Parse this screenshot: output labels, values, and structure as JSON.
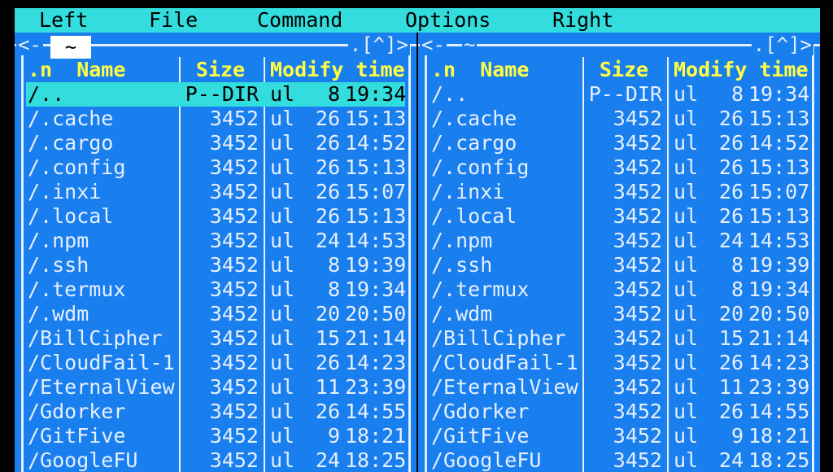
{
  "menu": {
    "items": [
      {
        "label": "Left"
      },
      {
        "label": "File"
      },
      {
        "label": "Command"
      },
      {
        "label": "Options"
      },
      {
        "label": "Right"
      }
    ]
  },
  "colors": {
    "panel_bg": "#1a7fee",
    "menu_bg": "#33dddd",
    "header_text": "#ffff44",
    "text": "#e6efff",
    "selection_bg": "#33dddd"
  },
  "left_panel": {
    "corner_arrow": "<-",
    "path": "~",
    "tools": ".[^]>",
    "headers": {
      "name": ".n  Name",
      "size": "Size",
      "time": "Modify time"
    },
    "selected_index": 0,
    "rows": [
      {
        "name": "/..",
        "size": "P--DIR",
        "month": "ul",
        "day": "8",
        "clock": "19:34"
      },
      {
        "name": "/.cache",
        "size": "3452",
        "month": "ul",
        "day": "26",
        "clock": "15:13"
      },
      {
        "name": "/.cargo",
        "size": "3452",
        "month": "ul",
        "day": "26",
        "clock": "14:52"
      },
      {
        "name": "/.config",
        "size": "3452",
        "month": "ul",
        "day": "26",
        "clock": "15:13"
      },
      {
        "name": "/.inxi",
        "size": "3452",
        "month": "ul",
        "day": "26",
        "clock": "15:07"
      },
      {
        "name": "/.local",
        "size": "3452",
        "month": "ul",
        "day": "26",
        "clock": "15:13"
      },
      {
        "name": "/.npm",
        "size": "3452",
        "month": "ul",
        "day": "24",
        "clock": "14:53"
      },
      {
        "name": "/.ssh",
        "size": "3452",
        "month": "ul",
        "day": "8",
        "clock": "19:39"
      },
      {
        "name": "/.termux",
        "size": "3452",
        "month": "ul",
        "day": "8",
        "clock": "19:34"
      },
      {
        "name": "/.wdm",
        "size": "3452",
        "month": "ul",
        "day": "20",
        "clock": "20:50"
      },
      {
        "name": "/BillCipher",
        "size": "3452",
        "month": "ul",
        "day": "15",
        "clock": "21:14"
      },
      {
        "name": "/CloudFail-1",
        "size": "3452",
        "month": "ul",
        "day": "26",
        "clock": "14:23"
      },
      {
        "name": "/EternalView",
        "size": "3452",
        "month": "ul",
        "day": "11",
        "clock": "23:39"
      },
      {
        "name": "/Gdorker",
        "size": "3452",
        "month": "ul",
        "day": "26",
        "clock": "14:55"
      },
      {
        "name": "/GitFive",
        "size": "3452",
        "month": "ul",
        "day": "9",
        "clock": "18:21"
      },
      {
        "name": "/GoogleFU",
        "size": "3452",
        "month": "ul",
        "day": "24",
        "clock": "18:25"
      }
    ]
  },
  "right_panel": {
    "corner_arrow": "<-",
    "path": "~",
    "tools": ".[^]>",
    "headers": {
      "name": ".n  Name",
      "size": "Size",
      "time": "Modify time"
    },
    "selected_index": -1,
    "rows": [
      {
        "name": "/..",
        "size": "P--DIR",
        "month": "ul",
        "day": "8",
        "clock": "19:34"
      },
      {
        "name": "/.cache",
        "size": "3452",
        "month": "ul",
        "day": "26",
        "clock": "15:13"
      },
      {
        "name": "/.cargo",
        "size": "3452",
        "month": "ul",
        "day": "26",
        "clock": "14:52"
      },
      {
        "name": "/.config",
        "size": "3452",
        "month": "ul",
        "day": "26",
        "clock": "15:13"
      },
      {
        "name": "/.inxi",
        "size": "3452",
        "month": "ul",
        "day": "26",
        "clock": "15:07"
      },
      {
        "name": "/.local",
        "size": "3452",
        "month": "ul",
        "day": "26",
        "clock": "15:13"
      },
      {
        "name": "/.npm",
        "size": "3452",
        "month": "ul",
        "day": "24",
        "clock": "14:53"
      },
      {
        "name": "/.ssh",
        "size": "3452",
        "month": "ul",
        "day": "8",
        "clock": "19:39"
      },
      {
        "name": "/.termux",
        "size": "3452",
        "month": "ul",
        "day": "8",
        "clock": "19:34"
      },
      {
        "name": "/.wdm",
        "size": "3452",
        "month": "ul",
        "day": "20",
        "clock": "20:50"
      },
      {
        "name": "/BillCipher",
        "size": "3452",
        "month": "ul",
        "day": "15",
        "clock": "21:14"
      },
      {
        "name": "/CloudFail-1",
        "size": "3452",
        "month": "ul",
        "day": "26",
        "clock": "14:23"
      },
      {
        "name": "/EternalView",
        "size": "3452",
        "month": "ul",
        "day": "11",
        "clock": "23:39"
      },
      {
        "name": "/Gdorker",
        "size": "3452",
        "month": "ul",
        "day": "26",
        "clock": "14:55"
      },
      {
        "name": "/GitFive",
        "size": "3452",
        "month": "ul",
        "day": "9",
        "clock": "18:21"
      },
      {
        "name": "/GoogleFU",
        "size": "3452",
        "month": "ul",
        "day": "24",
        "clock": "18:25"
      }
    ]
  }
}
